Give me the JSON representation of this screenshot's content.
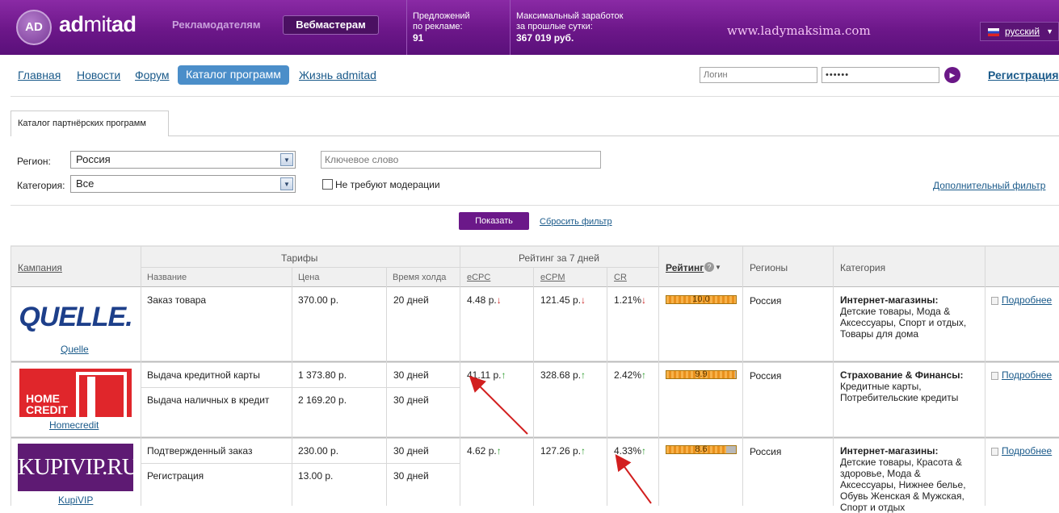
{
  "header": {
    "logo_text": "AD",
    "brand_part1": "ad",
    "brand_part2": "mit",
    "brand_part3": "ad",
    "advertisers": "Рекламодателям",
    "webmasters": "Вебмастерам",
    "offers_label1": "Предложений",
    "offers_label2": "по рекламе:",
    "offers_value": "91",
    "earn_label1": "Максимальный заработок",
    "earn_label2": "за прошлые сутки:",
    "earn_value": "367 019 руб.",
    "watermark": "www.ladymaksima.com",
    "language": "русский"
  },
  "nav": {
    "home": "Главная",
    "news": "Новости",
    "forum": "Форум",
    "catalog": "Каталог программ",
    "life": "Жизнь admitad",
    "login_placeholder": "Логин",
    "password_value": "••••••",
    "register": "Регистрация"
  },
  "tabs": {
    "catalog": "Каталог партнёрских программ"
  },
  "filter": {
    "region_label": "Регион:",
    "region_value": "Россия",
    "category_label": "Категория:",
    "category_value": "Все",
    "keyword_placeholder": "Ключевое слово",
    "no_moderation": "Не требуют модерации",
    "advanced": "Дополнительный фильтр",
    "show": "Показать",
    "reset": "Сбросить фильтр"
  },
  "table": {
    "campaign": "Кампания",
    "tariffs": "Тарифы",
    "rating7": "Рейтинг за 7 дней",
    "rating": "Рейтинг",
    "regions": "Регионы",
    "category": "Категория",
    "name": "Название",
    "price": "Цена",
    "hold": "Время холда",
    "ecpc": "eCPC",
    "ecpm": "eCPM",
    "cr": "CR"
  },
  "rows": [
    {
      "name": "Quelle",
      "logo": "QUELLE.",
      "t1_name": "Заказ товара",
      "t1_price": "370.00 р.",
      "t1_hold": "20 дней",
      "ecpc": "4.48 р.",
      "ecpm": "121.45 р.",
      "cr": "1.21%",
      "rating": 10.0,
      "rating_text": "10.0",
      "region": "Россия",
      "cat_title": "Интернет-магазины:",
      "cat_text": "Детские товары, Мода & Аксессуары, Спорт и отдых, Товары для дома",
      "more": "Подробнее"
    },
    {
      "name": "Homecredit",
      "logo1": "HOME",
      "logo2": "CREDIT",
      "t1_name": "Выдача кредитной карты",
      "t1_price": "1 373.80 р.",
      "t1_hold": "30 дней",
      "t2_name": "Выдача наличных в кредит",
      "t2_price": "2 169.20 р.",
      "t2_hold": "30 дней",
      "ecpc": "41.11 р.",
      "ecpm": "328.68 р.",
      "cr": "2.42%",
      "rating": 9.9,
      "rating_text": "9.9",
      "region": "Россия",
      "cat_title": "Страхование & Финансы:",
      "cat_text": "Кредитные карты, Потребительские кредиты",
      "more": "Подробнее"
    },
    {
      "name": "KupiVIP",
      "logo": "KUPIVIP.RU",
      "t1_name": "Подтвержденный заказ",
      "t1_price": "230.00 р.",
      "t1_hold": "30 дней",
      "t2_name": "Регистрация",
      "t2_price": "13.00 р.",
      "t2_hold": "30 дней",
      "ecpc": "4.62 р.",
      "ecpm": "127.26 р.",
      "cr": "4.33%",
      "rating": 8.6,
      "rating_text": "8.6",
      "region": "Россия",
      "cat_title": "Интернет-магазины:",
      "cat_text": "Детские товары, Красота & здоровье, Мода & Аксессуары, Нижнее белье, Обувь Женская & Мужская, Спорт и отдых",
      "more": "Подробнее"
    }
  ],
  "arrows": {
    "up": "↑",
    "down": "↓"
  },
  "colors": {
    "header": "#6c1789",
    "accent_button": "#6b1889",
    "nav_active": "#4b8ec9",
    "link": "#1a5a8a",
    "annotation_arrow": "#d21f1f"
  }
}
